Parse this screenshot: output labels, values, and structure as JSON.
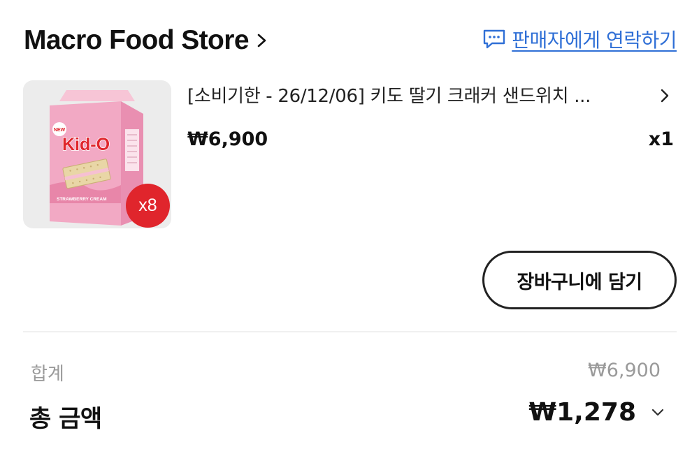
{
  "store": {
    "name": "Macro Food Store",
    "contact_label": "판매자에게 연락하기"
  },
  "product": {
    "title": "[소비기한 - 26/12/06] 키도 딸기 크래커 샌드위치 ...",
    "price": "₩6,900",
    "quantity": "x1",
    "pack_badge": "x8",
    "package": {
      "brand": "Kid-O",
      "flag": "NEW",
      "flavor": "STRAWBERRY CREAM"
    }
  },
  "actions": {
    "add_to_cart": "장바구니에 담기"
  },
  "summary": {
    "subtotal_label": "합계",
    "subtotal_value": "₩6,900",
    "total_label": "총 금액",
    "total_value": "₩1,278"
  },
  "colors": {
    "link_blue": "#2f6fd6",
    "badge_red": "#e0252c",
    "package_pink": "#f2a9c4"
  }
}
